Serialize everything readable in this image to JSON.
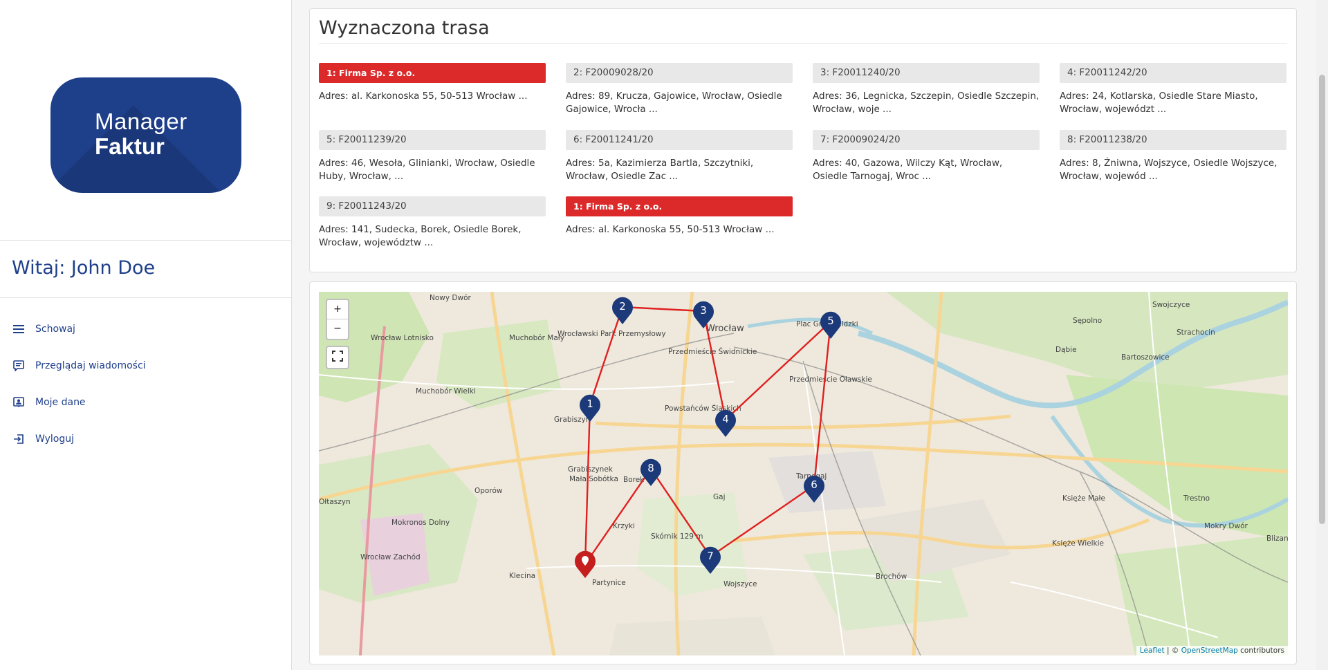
{
  "brand": {
    "line1": "Manager",
    "line2": "Faktur"
  },
  "greeting": "Witaj: John Doe",
  "menu": [
    {
      "label": "Schowaj",
      "icon": "menu-icon"
    },
    {
      "label": "Przeglądaj wiadomości",
      "icon": "message-icon"
    },
    {
      "label": "Moje dane",
      "icon": "profile-icon"
    },
    {
      "label": "Wyloguj",
      "icon": "logout-icon"
    }
  ],
  "route": {
    "title": "Wyznaczona trasa",
    "stops": [
      {
        "header": "1: Firma Sp. z o.o.",
        "address": "Adres: al. Karkonoska 55, 50-513 Wrocław ...",
        "active": true
      },
      {
        "header": "2: F20009028/20",
        "address": "Adres: 89, Krucza, Gajowice, Wrocław, Osiedle Gajowice, Wrocła ...",
        "active": false
      },
      {
        "header": "3: F20011240/20",
        "address": "Adres: 36, Legnicka, Szczepin, Osiedle Szczepin, Wrocław, woje ...",
        "active": false
      },
      {
        "header": "4: F20011242/20",
        "address": "Adres: 24, Kotlarska, Osiedle Stare Miasto, Wrocław, województ ...",
        "active": false
      },
      {
        "header": "5: F20011239/20",
        "address": "Adres: 46, Wesoła, Glinianki, Wrocław, Osiedle Huby, Wrocław, ...",
        "active": false
      },
      {
        "header": "6: F20011241/20",
        "address": "Adres: 5a, Kazimierza Bartla, Szczytniki, Wrocław, Osiedle Zac ...",
        "active": false
      },
      {
        "header": "7: F20009024/20",
        "address": "Adres: 40, Gazowa, Wilczy Kąt, Wrocław, Osiedle Tarnogaj, Wroc ...",
        "active": false
      },
      {
        "header": "8: F20011238/20",
        "address": "Adres: 8, Żniwna, Wojszyce, Osiedle Wojszyce, Wrocław, wojewód ...",
        "active": false
      },
      {
        "header": "9: F20011243/20",
        "address": "Adres: 141, Sudecka, Borek, Osiedle Borek, Wrocław, województw ...",
        "active": false
      },
      {
        "header": "1: Firma Sp. z o.o.",
        "address": "Adres: al. Karkonoska 55, 50-513 Wrocław ...",
        "active": true
      }
    ]
  },
  "map": {
    "zoom_in": "+",
    "zoom_out": "−",
    "attribution": {
      "leaflet": "Leaflet",
      "sep": " | © ",
      "osm": "OpenStreetMap",
      "suffix": " contributors"
    },
    "markers": [
      "1",
      "2",
      "3",
      "4",
      "5",
      "6",
      "7",
      "8"
    ],
    "labels": [
      "Nowy Dwór",
      "Muchobór Mały",
      "Wrocławski Park Przemysłowy",
      "Przedmieście Świdnickie",
      "Wrocław",
      "Plac Grunwaldzki",
      "Sępolno",
      "Swojczyce",
      "Strachocin",
      "Dąbie",
      "Bartoszowice",
      "Muchobór Wielki",
      "Wrocław Lotnisko",
      "Grabiszyn",
      "Powstańców Śląskich",
      "Przedmieście Oławskie",
      "Grabiszynek",
      "Mała Sobótka",
      "Borek",
      "Oporów",
      "Gaj",
      "Tarnogaj",
      "Księże Małe",
      "Trestno",
      "Mokronos Dolny",
      "Krzyki",
      "Skórnik 129 m",
      "Księże Wielkie",
      "Mokry Dwór",
      "Klecina",
      "Partynice",
      "Wojszyce",
      "Brochów",
      "Blizan",
      "Wrocław Zachód",
      "Ołtaszyn"
    ],
    "colors": {
      "route": "#e02020",
      "marker": "#1c3a7a",
      "start_marker": "#c41e1e"
    }
  }
}
